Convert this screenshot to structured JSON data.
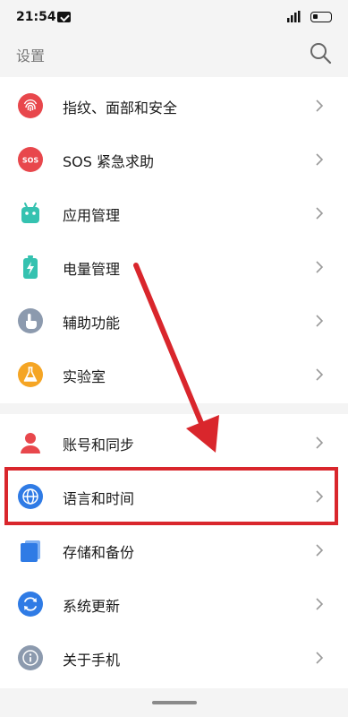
{
  "status_bar": {
    "time": "21:54"
  },
  "header": {
    "title": "设置"
  },
  "settings": {
    "group1": [
      {
        "label": "指纹、面部和安全",
        "icon": "fingerprint-icon",
        "color": "#e8474c"
      },
      {
        "label": "SOS 紧急求助",
        "icon": "sos-icon",
        "color": "#e8474c",
        "icon_text": "SOS"
      },
      {
        "label": "应用管理",
        "icon": "android-icon",
        "color": "#35c2b0"
      },
      {
        "label": "电量管理",
        "icon": "battery-icon",
        "color": "#35c2b0"
      },
      {
        "label": "辅助功能",
        "icon": "hand-icon",
        "color": "#8c9aae"
      },
      {
        "label": "实验室",
        "icon": "flask-icon",
        "color": "#f5a524"
      }
    ],
    "group2": [
      {
        "label": "账号和同步",
        "icon": "person-icon",
        "color": "#e8474c"
      },
      {
        "label": "语言和时间",
        "icon": "globe-icon",
        "color": "#2f7be5"
      },
      {
        "label": "存储和备份",
        "icon": "storage-icon",
        "color": "#2f7be5"
      },
      {
        "label": "系统更新",
        "icon": "update-icon",
        "color": "#2f7be5"
      },
      {
        "label": "关于手机",
        "icon": "info-icon",
        "color": "#8c9aae"
      }
    ]
  },
  "annotation": {
    "color": "#d9262c"
  }
}
